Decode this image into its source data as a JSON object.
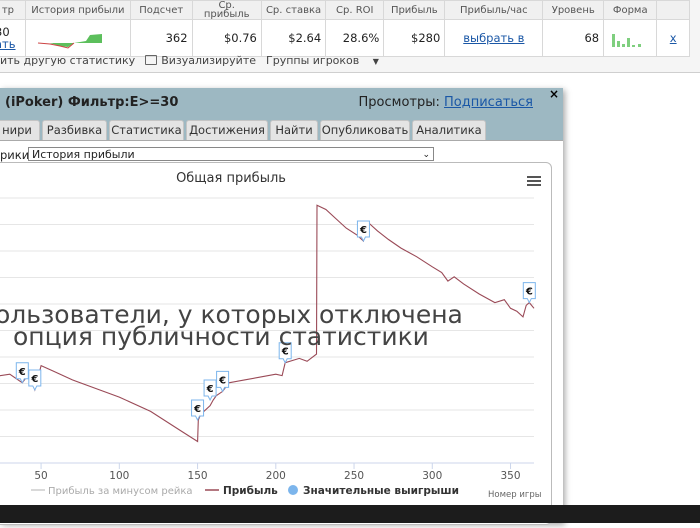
{
  "top_table": {
    "headers": [
      "тр",
      "История прибыли",
      "Подсчет",
      "Ср. прибыль",
      "Ср. ставка",
      "Ср. ROI",
      "Прибыль",
      "Прибыль/час",
      "Уровень",
      "Форма",
      ""
    ],
    "row": {
      "first_top": "30",
      "first_link": "ать",
      "count": "362",
      "avg_profit": "$0.76",
      "avg_stake": "$2.64",
      "roi": "28.6%",
      "profit": "$280",
      "per_hour": "выбрать в",
      "level": "68",
      "remove": "x"
    }
  },
  "below_table": {
    "other_stats": "ить другую статистику",
    "visualize": "Визуализируйте",
    "groups": "Группы игроков"
  },
  "dialog": {
    "title": "(iPoker) Фильтр:E>=30",
    "views_label": "Просмотры:",
    "subscribe": "Подписаться",
    "close": "×",
    "tabs": [
      "нири",
      "Разбивка",
      "Статистика",
      "Достижения",
      "Найти",
      "Опубликовать",
      "Аналитика"
    ],
    "select_label": "рики:",
    "select_value": "История прибыли"
  },
  "chart_data": {
    "type": "line",
    "title": "Общая прибыль",
    "xlabel": "Номер игры",
    "x_ticks": [
      50,
      100,
      150,
      200,
      250,
      300,
      350
    ],
    "xlim": [
      18,
      365
    ],
    "series": [
      {
        "name": "Прибыль",
        "color": "#9a4a57",
        "x": [
          18,
          30,
          38,
          42,
          46,
          50,
          58,
          70,
          85,
          100,
          120,
          140,
          150,
          150.5,
          152,
          158,
          160,
          162,
          166,
          170,
          180,
          190,
          200,
          204,
          206,
          215,
          220,
          226,
          226.3,
          232,
          238,
          245,
          252,
          256,
          257,
          259,
          265,
          272,
          280,
          290,
          300,
          306,
          310,
          314,
          320,
          330,
          340,
          346,
          350,
          354,
          358,
          360,
          362,
          365
        ],
        "y": [
          20,
          22,
          16,
          22,
          11,
          28,
          24,
          18,
          12,
          6,
          -4,
          -18,
          -25,
          -10,
          -6,
          0,
          4,
          7,
          10,
          16,
          18,
          20,
          22,
          21,
          30,
          33,
          31,
          36,
          140,
          137,
          131,
          124,
          119,
          115,
          122,
          128,
          122,
          116,
          110,
          104,
          97,
          93,
          87,
          90,
          85,
          78,
          72,
          74,
          68,
          66,
          62,
          70,
          72,
          68
        ]
      },
      {
        "name": "Прибыль за минусом рейка",
        "color": "#cccccc",
        "x": [],
        "y": []
      }
    ],
    "markers": {
      "name": "Значительные выигрыши",
      "symbol": "€",
      "x": [
        38,
        46,
        150,
        158,
        166,
        206,
        256,
        362
      ],
      "y": [
        16,
        11,
        -10,
        4,
        10,
        30,
        115,
        72
      ]
    },
    "legend": [
      "Прибыль за минусом рейка",
      "Прибыль",
      "Значительные выигрыши"
    ],
    "legend_position": "bottom"
  },
  "overlay_text": {
    "line1": "ользователи, у которых отключена",
    "line2": "опция публичности статистики"
  },
  "colors": {
    "dialog_header": "#9db8c2",
    "link": "#1a57a6",
    "profit_line": "#9a4a57",
    "marker_dot": "#7cb5ec"
  }
}
